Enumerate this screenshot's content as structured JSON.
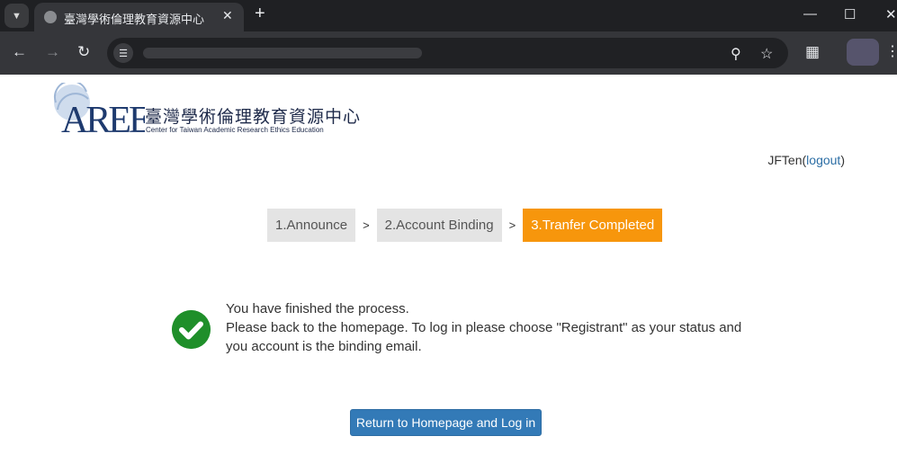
{
  "browser": {
    "tab_title": "臺灣學術倫理教育資源中心",
    "icons": {
      "tab_menu": "chevron-down-icon",
      "close_tab": "close-icon",
      "new_tab": "plus-icon",
      "minimize": "minimize-icon",
      "maximize": "maximize-icon",
      "close_window": "close-icon",
      "back": "back-arrow-icon",
      "forward": "forward-arrow-icon",
      "reload": "reload-icon",
      "site_info": "tune-icon",
      "zoom": "zoom-icon",
      "bookmark": "star-icon",
      "extensions": "puzzle-icon",
      "menu": "more-vertical-icon"
    }
  },
  "logo": {
    "title_cn": "臺灣學術倫理教育資源中心",
    "title_en": "Center for Taiwan Academic Research Ethics Education",
    "mark_text": "AREE"
  },
  "user": {
    "name": "JFTen",
    "logout_label": "logout",
    "open_paren": "(",
    "close_paren": ")"
  },
  "steps": [
    {
      "label": "1.Announce",
      "active": false
    },
    {
      "label": "2.Account Binding",
      "active": false
    },
    {
      "label": "3.Tranfer Completed",
      "active": true
    }
  ],
  "step_separator": ">",
  "message": {
    "line1": "You have finished the process.",
    "line2": "Please back to the homepage. To log in please choose \"Registrant\" as your status and you account is the binding email."
  },
  "button": {
    "label": "Return to Homepage and Log in"
  },
  "colors": {
    "active_step": "#f7960c",
    "inactive_step": "#e4e4e4",
    "success": "#1f8f2a",
    "primary_button": "#337ab7",
    "link": "#2c6ea5"
  }
}
